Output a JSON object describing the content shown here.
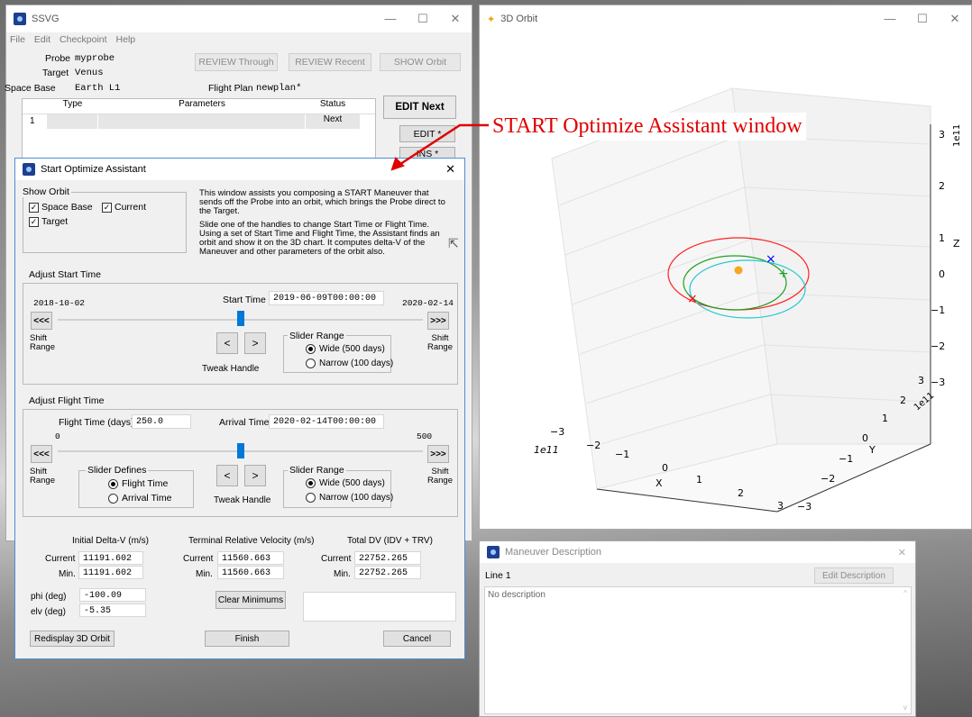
{
  "ssvg": {
    "title": "SSVG",
    "menu": [
      "File",
      "Edit",
      "Checkpoint",
      "Help"
    ],
    "probe_label": "Probe",
    "probe": "myprobe",
    "target_label": "Target",
    "target": "Venus",
    "base_label": "Space Base",
    "base": "Earth L1",
    "plan_label": "Flight Plan",
    "plan": "newplan*",
    "btn_review_through": "REVIEW Through",
    "btn_review_recent": "REVIEW Recent",
    "btn_show_orbit": "SHOW Orbit",
    "btn_edit_next": "EDIT Next",
    "btn_edit": "EDIT *",
    "btn_ins": "INS *",
    "table": {
      "headers": [
        "Type",
        "Parameters",
        "Status"
      ],
      "rows": [
        {
          "num": "1",
          "type": "",
          "params": "",
          "status": "Next"
        }
      ]
    }
  },
  "annotation": "START Optimize Assistant window",
  "orbit3d": {
    "title": "3D Orbit",
    "z_label": "Z",
    "x_label": "X",
    "y_label": "Y",
    "z_exp": "1e11",
    "x_exp": "1e11",
    "y_exp": "1e11",
    "z_ticks": [
      "3",
      "2",
      "1",
      "0",
      "−1",
      "−2",
      "−3"
    ],
    "x_ticks": [
      "−3",
      "−2",
      "−1",
      "0",
      "1",
      "2",
      "3"
    ],
    "y_ticks": [
      "−3",
      "−2",
      "−1",
      "0",
      "1",
      "2",
      "3"
    ],
    "colors": {
      "sun": "#f5a623",
      "earth": "#ff2020",
      "target": "#20a020",
      "probe": "#20c8d0",
      "start": "#ff0000",
      "end": "#0000ff"
    }
  },
  "maneuver": {
    "title": "Maneuver Description",
    "line": "Line 1",
    "btn_edit": "Edit Description",
    "desc": "No description"
  },
  "soa": {
    "title": "Start Optimize Assistant",
    "show_orbit_label": "Show Orbit",
    "chk_space_base": "Space Base",
    "chk_current": "Current",
    "chk_target": "Target",
    "info": "This window assists you composing a START Maneuver that sends off the Probe into an orbit, which brings the Probe direct to the Target.",
    "info2": "Slide one of the handles to change Start Time or Flight Time. Using a set of Start Time and Flight Time, the Assistant finds an orbit and show it on the 3D chart. It computes delta-V of the Maneuver and other parameters of the orbit also.",
    "adj_start": "Adjust Start Time",
    "start_min": "2018-10-02",
    "start_max": "2020-02-14",
    "start_time_label": "Start Time",
    "start_time": "2019-06-09T00:00:00",
    "start_slider": 0.5,
    "shift_left": "<<<",
    "shift_right": ">>>",
    "shift_range": "Shift Range",
    "tweak_left": "<",
    "tweak_right": ">",
    "tweak_handle": "Tweak Handle",
    "slider_range": "Slider Range",
    "wide": "Wide  (500 days)",
    "narrow": "Narrow (100 days)",
    "adj_flight": "Adjust Flight Time",
    "flight_label": "Flight Time (days)",
    "flight": "250.0",
    "arrival_label": "Arrival Time",
    "arrival": "2020-02-14T00:00:00",
    "flight_min": "0",
    "flight_max": "500",
    "flight_slider": 0.5,
    "slider_defines": "Slider Defines",
    "def_flight": "Flight Time",
    "def_arrival": "Arrival Time",
    "idv_label": "Initial Delta-V (m/s)",
    "trv_label": "Terminal Relative Velocity (m/s)",
    "tdv_label": "Total DV (IDV + TRV)",
    "current_label": "Current",
    "min_label": "Min.",
    "idv_cur": "11191.602",
    "idv_min": "11191.602",
    "trv_cur": "11560.663",
    "trv_min": "11560.663",
    "tdv_cur": "22752.265",
    "tdv_min": "22752.265",
    "phi_label": "phi (deg)",
    "phi": "-100.09",
    "elv_label": "elv (deg)",
    "elv": "-5.35",
    "btn_clear": "Clear Minimums",
    "btn_redisplay": "Redisplay 3D Orbit",
    "btn_finish": "Finish",
    "btn_cancel": "Cancel"
  }
}
